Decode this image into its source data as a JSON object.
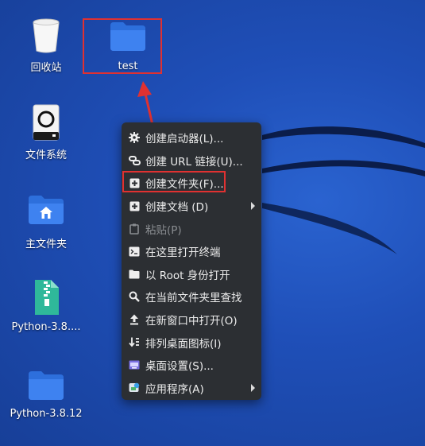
{
  "desktop": {
    "icons": [
      {
        "label": "回收站"
      },
      {
        "label": "test"
      },
      {
        "label": "文件系统"
      },
      {
        "label": "主文件夹"
      },
      {
        "label": "Python-3.8...."
      },
      {
        "label": "Python-3.8.12"
      }
    ]
  },
  "context_menu": {
    "items": [
      {
        "label": "创建启动器(L)...",
        "icon": "gear-icon"
      },
      {
        "label": "创建 URL 链接(U)...",
        "icon": "link-icon"
      },
      {
        "label": "创建文件夹(F)...",
        "icon": "new-folder-icon"
      },
      {
        "label": "创建文档 (D)",
        "icon": "new-document-icon"
      },
      {
        "label": "粘贴(P)",
        "icon": "clipboard-icon"
      },
      {
        "label": "在这里打开终端",
        "icon": "terminal-icon"
      },
      {
        "label": "以 Root 身份打开",
        "icon": "folder-icon"
      },
      {
        "label": "在当前文件夹里查找",
        "icon": "search-icon"
      },
      {
        "label": "在新窗口中打开(O)",
        "icon": "upload-arrow-icon"
      },
      {
        "label": "排列桌面图标(I)",
        "icon": "sort-icon"
      },
      {
        "label": "桌面设置(S)...",
        "icon": "desktop-settings-icon"
      },
      {
        "label": "应用程序(A)",
        "icon": "applications-icon"
      }
    ]
  },
  "colors": {
    "highlight": "#e03131",
    "menu_bg": "#2c2f33",
    "folder_blue": "#3b7be8"
  }
}
